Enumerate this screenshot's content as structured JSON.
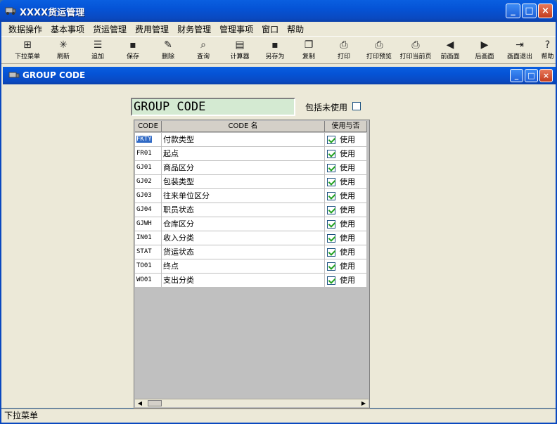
{
  "window": {
    "title": "XXXX货运管理",
    "controls": [
      "_",
      "□",
      "×"
    ]
  },
  "menu": [
    "数据操作",
    "基本事项",
    "货运管理",
    "费用管理",
    "财务管理",
    "管理事项",
    "窗口",
    "帮助"
  ],
  "toolbar": [
    {
      "label": "下拉菜单",
      "icon": "dropdown-menu-icon",
      "glyph": "⊞"
    },
    {
      "label": "刷新",
      "icon": "refresh-icon",
      "glyph": "✳"
    },
    {
      "label": "追加",
      "icon": "append-icon",
      "glyph": "☰"
    },
    {
      "label": "保存",
      "icon": "save-icon",
      "glyph": "▪"
    },
    {
      "label": "删除",
      "icon": "delete-icon",
      "glyph": "✎"
    },
    {
      "label": "查询",
      "icon": "query-icon",
      "glyph": "⌕"
    },
    {
      "label": "计算器",
      "icon": "calculator-icon",
      "glyph": "▤"
    },
    {
      "label": "另存为",
      "icon": "save-as-icon",
      "glyph": "▪"
    },
    {
      "label": "复制",
      "icon": "copy-icon",
      "glyph": "❐"
    },
    {
      "label": "打印",
      "icon": "print-icon",
      "glyph": "⎙"
    },
    {
      "label": "打印预览",
      "icon": "print-preview-icon",
      "glyph": "⎙"
    },
    {
      "label": "打印当前页",
      "icon": "print-current-page-icon",
      "glyph": "⎙"
    },
    {
      "label": "前画面",
      "icon": "previous-screen-icon",
      "glyph": "◀"
    },
    {
      "label": "后画面",
      "icon": "next-screen-icon",
      "glyph": "▶"
    },
    {
      "label": "画面退出",
      "icon": "exit-screen-icon",
      "glyph": "⇥"
    },
    {
      "label": "帮助",
      "icon": "help-icon",
      "glyph": "?"
    }
  ],
  "child_window": {
    "title": "GROUP  CODE",
    "controls": [
      "_",
      "□",
      "×"
    ]
  },
  "form": {
    "header": "GROUP   CODE",
    "include_unused_label": "包括未使用",
    "include_unused_checked": false
  },
  "grid": {
    "columns": [
      "CODE",
      "CODE 名",
      "使用与否"
    ],
    "rows": [
      {
        "code": "FKTY",
        "name": "付款类型",
        "use": "使用",
        "checked": true,
        "selected": true
      },
      {
        "code": "FR01",
        "name": "起点",
        "use": "使用",
        "checked": true
      },
      {
        "code": "GJ01",
        "name": "商品区分",
        "use": "使用",
        "checked": true
      },
      {
        "code": "GJ02",
        "name": "包装类型",
        "use": "使用",
        "checked": true
      },
      {
        "code": "GJ03",
        "name": "往来单位区分",
        "use": "使用",
        "checked": true
      },
      {
        "code": "GJ04",
        "name": "职员状态",
        "use": "使用",
        "checked": true
      },
      {
        "code": "GJWH",
        "name": "仓库区分",
        "use": "使用",
        "checked": true
      },
      {
        "code": "IN01",
        "name": "收入分类",
        "use": "使用",
        "checked": true
      },
      {
        "code": "STAT",
        "name": "货运状态",
        "use": "使用",
        "checked": true
      },
      {
        "code": "TO01",
        "name": "终点",
        "use": "使用",
        "checked": true
      },
      {
        "code": "WO01",
        "name": "支出分类",
        "use": "使用",
        "checked": true
      }
    ]
  },
  "status": "下拉菜单",
  "colors": {
    "title_blue": "#0553d6",
    "face": "#ece9d8",
    "header_green": "#d4ead2",
    "check_green": "#21a121",
    "selection": "#316ac5"
  }
}
